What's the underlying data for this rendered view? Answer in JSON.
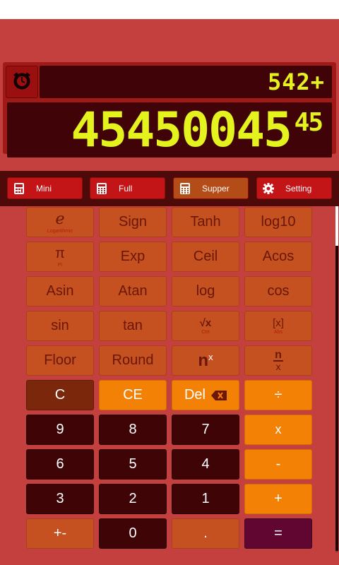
{
  "display": {
    "expression": "542+",
    "value_main": "45450045",
    "value_sup": "45"
  },
  "modes": [
    {
      "label": "Mini",
      "icon": "calculator-icon"
    },
    {
      "label": "Full",
      "icon": "calculator-icon"
    },
    {
      "label": "Supper",
      "icon": "calculator-icon"
    },
    {
      "label": "Setting",
      "icon": "gear-icon"
    }
  ],
  "keys": {
    "e": {
      "label": "e",
      "sub": "Logarithmic"
    },
    "sign": "Sign",
    "tanh": "Tanh",
    "log10": "log10",
    "pi": {
      "label": "π",
      "sub": "Pi"
    },
    "exp": "Exp",
    "ceil": "Ceil",
    "acos": "Acos",
    "asin": "Asin",
    "atan": "Atan",
    "log": "log",
    "cos": "cos",
    "sin": "sin",
    "tan": "tan",
    "sqrt": {
      "label": "√x",
      "sub": "Ctrt"
    },
    "abs": {
      "label": "[x]",
      "sub": "Abs"
    },
    "floor": "Floor",
    "round": "Round",
    "pow": {
      "base": "n",
      "exp": "x"
    },
    "frac": {
      "num": "n",
      "den": "x"
    },
    "c": "C",
    "ce": "CE",
    "del": "Del",
    "divide": "÷",
    "n9": "9",
    "n8": "8",
    "n7": "7",
    "multiply": "x",
    "n6": "6",
    "n5": "5",
    "n4": "4",
    "minus": "-",
    "n3": "3",
    "n2": "2",
    "n1": "1",
    "plus": "+",
    "plusminus": "+-",
    "n0": "0",
    "dot": ".",
    "equals": "="
  }
}
